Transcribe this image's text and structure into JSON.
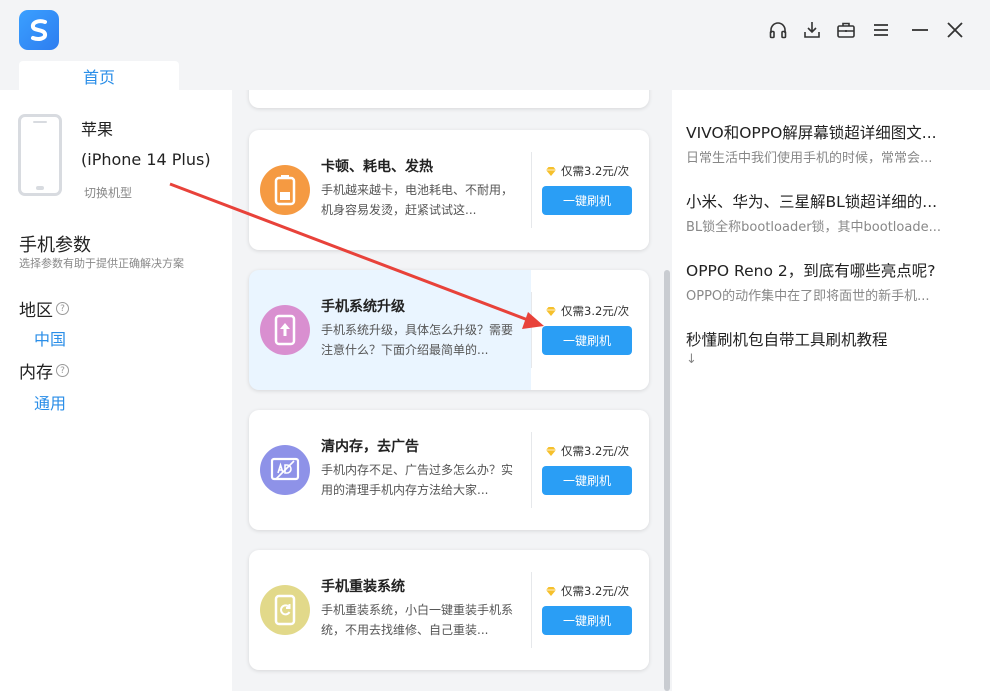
{
  "app": {
    "logo_letter": "S",
    "tab_home": "首页",
    "accent": "#2a8ee8",
    "button_color": "#2a9ef5"
  },
  "window_controls": [
    {
      "name": "headphone-icon"
    },
    {
      "name": "download-icon"
    },
    {
      "name": "briefcase-icon"
    },
    {
      "name": "menu-icon"
    },
    {
      "name": "minimize-icon"
    },
    {
      "name": "close-icon"
    }
  ],
  "device": {
    "brand": "苹果",
    "model": "(iPhone 14 Plus)",
    "switch_label": "切换机型"
  },
  "params": {
    "title": "手机参数",
    "subtitle": "选择参数有助于提供正确解决方案",
    "region_label": "地区",
    "region_value": "中国",
    "memory_label": "内存",
    "memory_value": "通用",
    "help_glyph": "?"
  },
  "cards": [
    {
      "title": "卡顿、耗电、发热",
      "desc": "手机越来越卡，电池耗电、不耐用，机身容易发烫，赶紧试试这...",
      "price": "仅需3.2元/次",
      "button": "一键刷机",
      "icon": "battery-icon",
      "icon_color": "#f59a42"
    },
    {
      "title": "手机系统升级",
      "desc": "手机系统升级，具体怎么升级？需要注意什么？下面介绍最简单的...",
      "price": "仅需3.2元/次",
      "button": "一键刷机",
      "icon": "phone-upgrade-icon",
      "icon_color": "#d98fd0"
    },
    {
      "title": "清内存，去广告",
      "desc": "手机内存不足、广告过多怎么办？实用的清理手机内存方法给大家...",
      "price": "仅需3.2元/次",
      "button": "一键刷机",
      "icon": "ad-block-icon",
      "icon_color": "#8e92e8"
    },
    {
      "title": "手机重装系统",
      "desc": "手机重装系统，小白一键重装手机系统，不用去找维修、自己重装...",
      "price": "仅需3.2元/次",
      "button": "一键刷机",
      "icon": "reinstall-icon",
      "icon_color": "#e2d98a"
    }
  ],
  "articles": [
    {
      "title": "VIVO和OPPO解屏幕锁超详细图文...",
      "summary": "日常生活中我们使用手机的时候，常常会..."
    },
    {
      "title": "小米、华为、三星解BL锁超详细的...",
      "summary": "BL锁全称bootloader锁，其中bootloade..."
    },
    {
      "title": "OPPO Reno 2，到底有哪些亮点呢?",
      "summary": "OPPO的动作集中在了即将面世的新手机..."
    },
    {
      "title": "秒懂刷机包自带工具刷机教程",
      "summary": "↓"
    }
  ],
  "annotation": {
    "color": "#e8423a"
  }
}
